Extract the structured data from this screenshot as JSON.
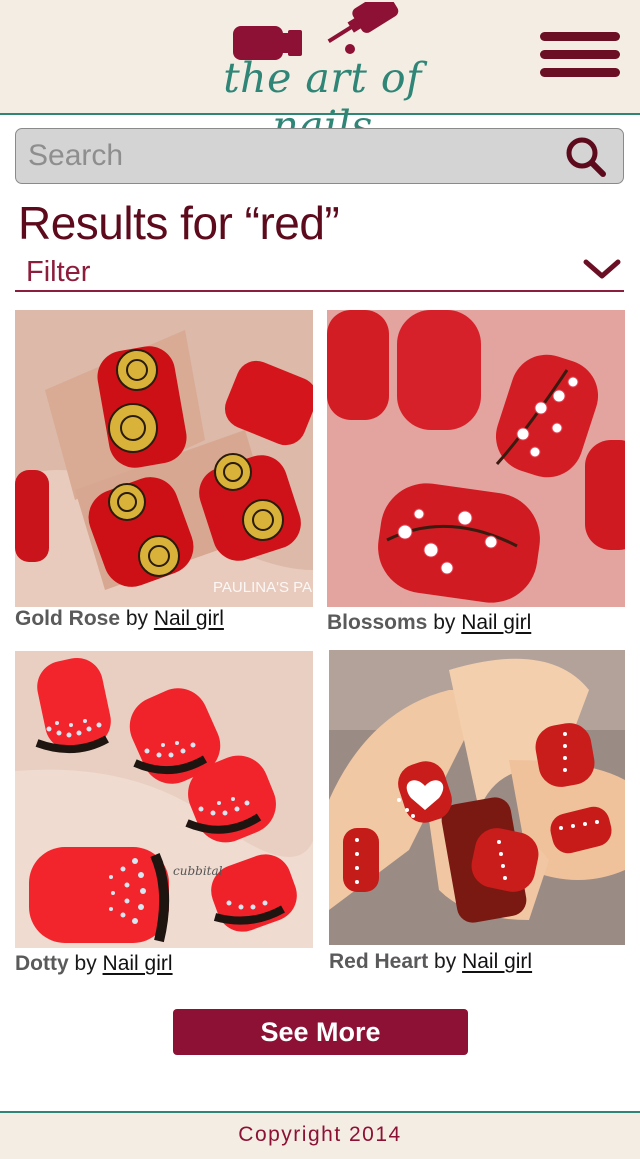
{
  "header": {
    "logo_text": "the art of nails",
    "menu_label": "menu"
  },
  "search": {
    "placeholder": "Search",
    "value": ""
  },
  "results": {
    "title": "Results for “red”",
    "filter_label": "Filter"
  },
  "cards": [
    {
      "name": "Gold Rose",
      "by": "by",
      "author": "Nail girl",
      "watermark": "PAULINA'S PAS"
    },
    {
      "name": "Blossoms",
      "by": "by",
      "author": "Nail girl"
    },
    {
      "name": "Dotty",
      "by": "by",
      "author": "Nail girl",
      "watermark": "cubbital"
    },
    {
      "name": "Red Heart",
      "by": "by",
      "author": "Nail girl"
    }
  ],
  "see_more_label": "See More",
  "footer": {
    "copyright": "Copyright 2014"
  },
  "colors": {
    "brand_teal": "#2f8576",
    "brand_maroon": "#6b0f24",
    "button_red": "#8c1134",
    "header_bg": "#f4ede4"
  },
  "icons": [
    "nail-polish-bottle-icon",
    "hamburger-menu-icon",
    "search-icon",
    "chevron-down-icon"
  ]
}
